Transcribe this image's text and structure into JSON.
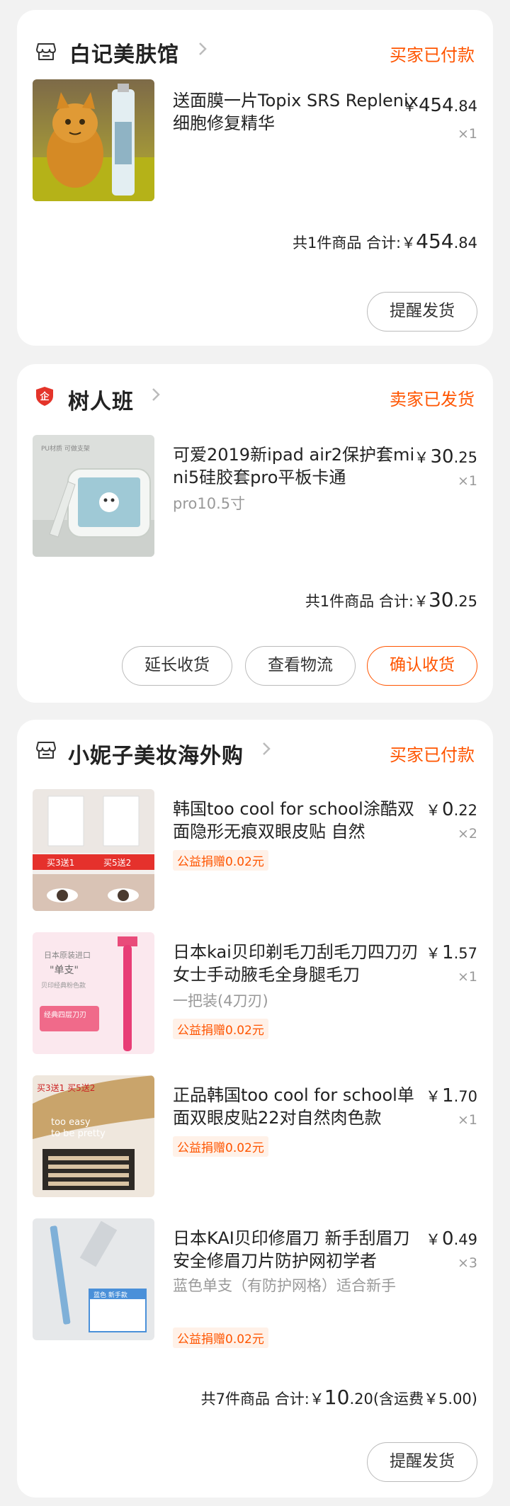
{
  "orders": [
    {
      "shop_name": "白记美肤馆",
      "status": "买家已付款",
      "items": [
        {
          "title": "送面膜一片Topix SRS Replenix 细胞修复精华",
          "price_int": "454",
          "price_dec": ".84",
          "qty": "×1"
        }
      ],
      "summary_count": "共1件商品",
      "summary_label": "合计:",
      "summary_int": "454",
      "summary_dec": ".84",
      "buttons": [
        "提醒发货"
      ]
    },
    {
      "shop_name": "树人班",
      "status": "卖家已发货",
      "items": [
        {
          "title": "可爱2019新ipad air2保护套mini5硅胶套pro平板卡通",
          "sku": "pro10.5寸",
          "price_int": "30",
          "price_dec": ".25",
          "qty": "×1"
        }
      ],
      "summary_count": "共1件商品",
      "summary_label": "合计:",
      "summary_int": "30",
      "summary_dec": ".25",
      "buttons": [
        "延长收货",
        "查看物流",
        "确认收货"
      ]
    },
    {
      "shop_name": "小妮子美妆海外购",
      "status": "买家已付款",
      "items": [
        {
          "title": "韩国too cool for school涂酷双面隐形无痕双眼皮贴 自然",
          "charity": "公益捐赠0.02元",
          "price_int": "0",
          "price_dec": ".22",
          "qty": "×2"
        },
        {
          "title": "日本kai贝印剃毛刀刮毛刀四刀刃女士手动腋毛全身腿毛刀",
          "sku": "一把装(4刀刃)",
          "charity": "公益捐赠0.02元",
          "price_int": "1",
          "price_dec": ".57",
          "qty": "×1"
        },
        {
          "title": "正品韩国too cool for school单面双眼皮贴22对自然肉色款",
          "charity": "公益捐赠0.02元",
          "price_int": "1",
          "price_dec": ".70",
          "qty": "×1"
        },
        {
          "title": "日本KAI贝印修眉刀 新手刮眉刀安全修眉刀片防护网初学者",
          "sku": "蓝色单支（有防护网格）适合新手",
          "charity": "公益捐赠0.02元",
          "price_int": "0",
          "price_dec": ".49",
          "qty": "×3"
        }
      ],
      "summary_count": "共7件商品",
      "summary_label": "合计:",
      "summary_int": "10",
      "summary_dec": ".20",
      "summary_shipping": "(含运费￥5.00)",
      "buttons": [
        "提醒发货"
      ]
    }
  ],
  "currency": "￥",
  "colors": {
    "accent": "#ff5500",
    "background": "#f2f2f2",
    "card": "#ffffff",
    "muted": "#999999"
  },
  "icons": {
    "store": "store-icon",
    "enterprise": "enterprise-badge-icon",
    "chevron": "chevron-right-icon"
  }
}
